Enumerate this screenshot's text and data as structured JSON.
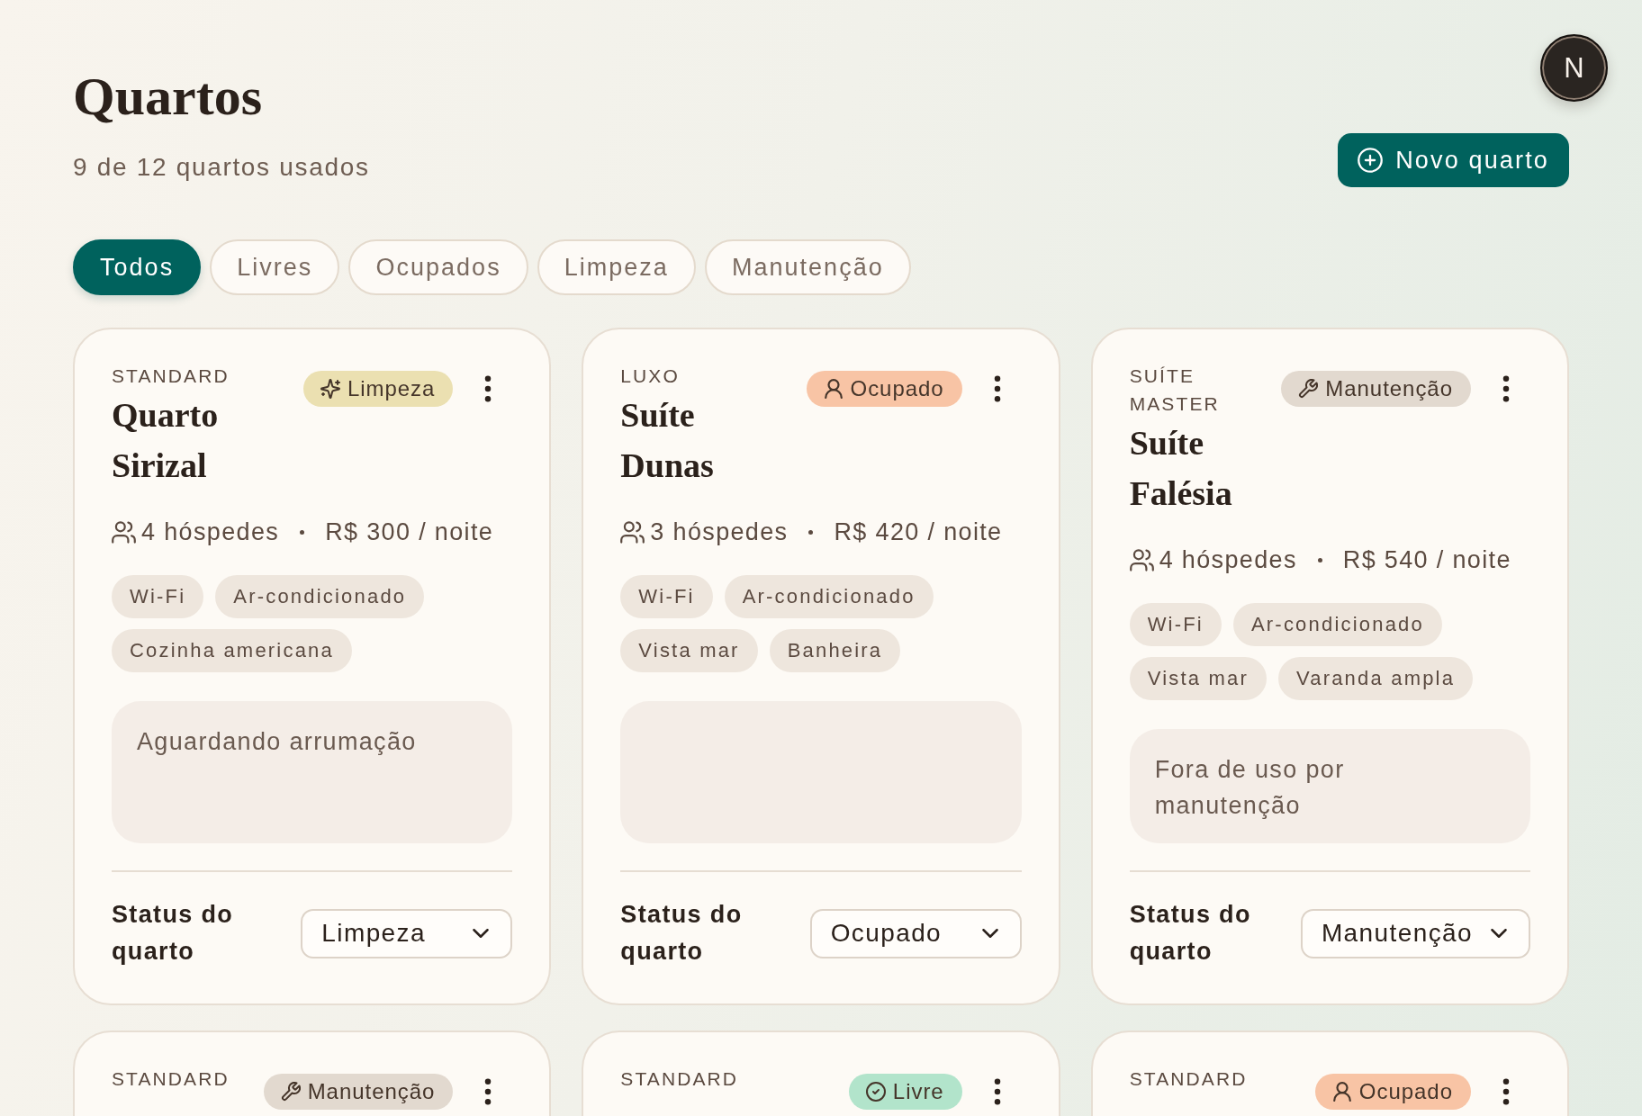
{
  "header": {
    "title": "Quartos",
    "subtitle": "9 de 12 quartos usados"
  },
  "user": {
    "initial": "N"
  },
  "new_button": {
    "label": "Novo quarto"
  },
  "filters": [
    {
      "label": "Todos",
      "selected": true
    },
    {
      "label": "Livres",
      "selected": false
    },
    {
      "label": "Ocupados",
      "selected": false
    },
    {
      "label": "Limpeza",
      "selected": false
    },
    {
      "label": "Manutenção",
      "selected": false
    }
  ],
  "rooms": [
    {
      "category": "STANDARD",
      "status": {
        "kind": "cleaning",
        "label": "Limpeza"
      },
      "name": "Quarto Sirizal",
      "guests": "4 hóspedes",
      "price": "R$ 300 / noite",
      "amenities": [
        "Wi-Fi",
        "Ar-condicionado",
        "Cozinha americana"
      ],
      "notes": "Aguardando arrumação",
      "status_label": "Status do quarto",
      "status_value": "Limpeza"
    },
    {
      "category": "LUXO",
      "status": {
        "kind": "occupied",
        "label": "Ocupado"
      },
      "name": "Suíte Dunas",
      "guests": "3 hóspedes",
      "price": "R$ 420 / noite",
      "amenities": [
        "Wi-Fi",
        "Ar-condicionado",
        "Vista mar",
        "Banheira"
      ],
      "status_label": "Status do quarto",
      "status_value": "Ocupado"
    },
    {
      "category": "SUÍTE MASTER",
      "status": {
        "kind": "maintenance",
        "label": "Manutenção"
      },
      "name": "Suíte Falésia",
      "guests": "4 hóspedes",
      "price": "R$ 540 / noite",
      "amenities": [
        "Wi-Fi",
        "Ar-condicionado",
        "Vista mar",
        "Varanda ampla"
      ],
      "notes": "Fora de uso por manutenção",
      "status_label": "Status do quarto",
      "status_value": "Manutenção"
    },
    {
      "category": "STANDARD",
      "status": {
        "kind": "maintenance",
        "label": "Manutenção"
      }
    },
    {
      "category": "STANDARD",
      "status": {
        "kind": "free",
        "label": "Livre"
      }
    },
    {
      "category": "STANDARD",
      "status": {
        "kind": "occupied",
        "label": "Ocupado"
      }
    }
  ]
}
